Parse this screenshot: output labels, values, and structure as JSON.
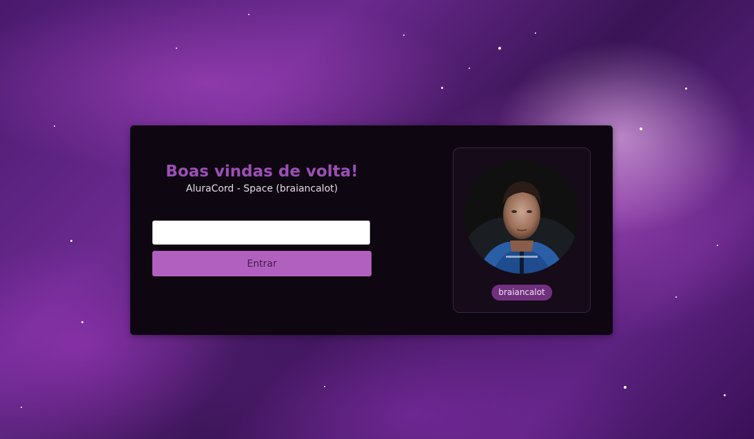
{
  "login": {
    "title": "Boas vindas de volta!",
    "subtitle": "AluraCord - Space (braiancalot)",
    "username_value": "",
    "enter_label": "Entrar"
  },
  "profile": {
    "username": "braiancalot"
  },
  "colors": {
    "accent": "#9b4fb6",
    "button": "#b260c0",
    "card_bg": "#0e0610",
    "chip": "#71307e"
  }
}
